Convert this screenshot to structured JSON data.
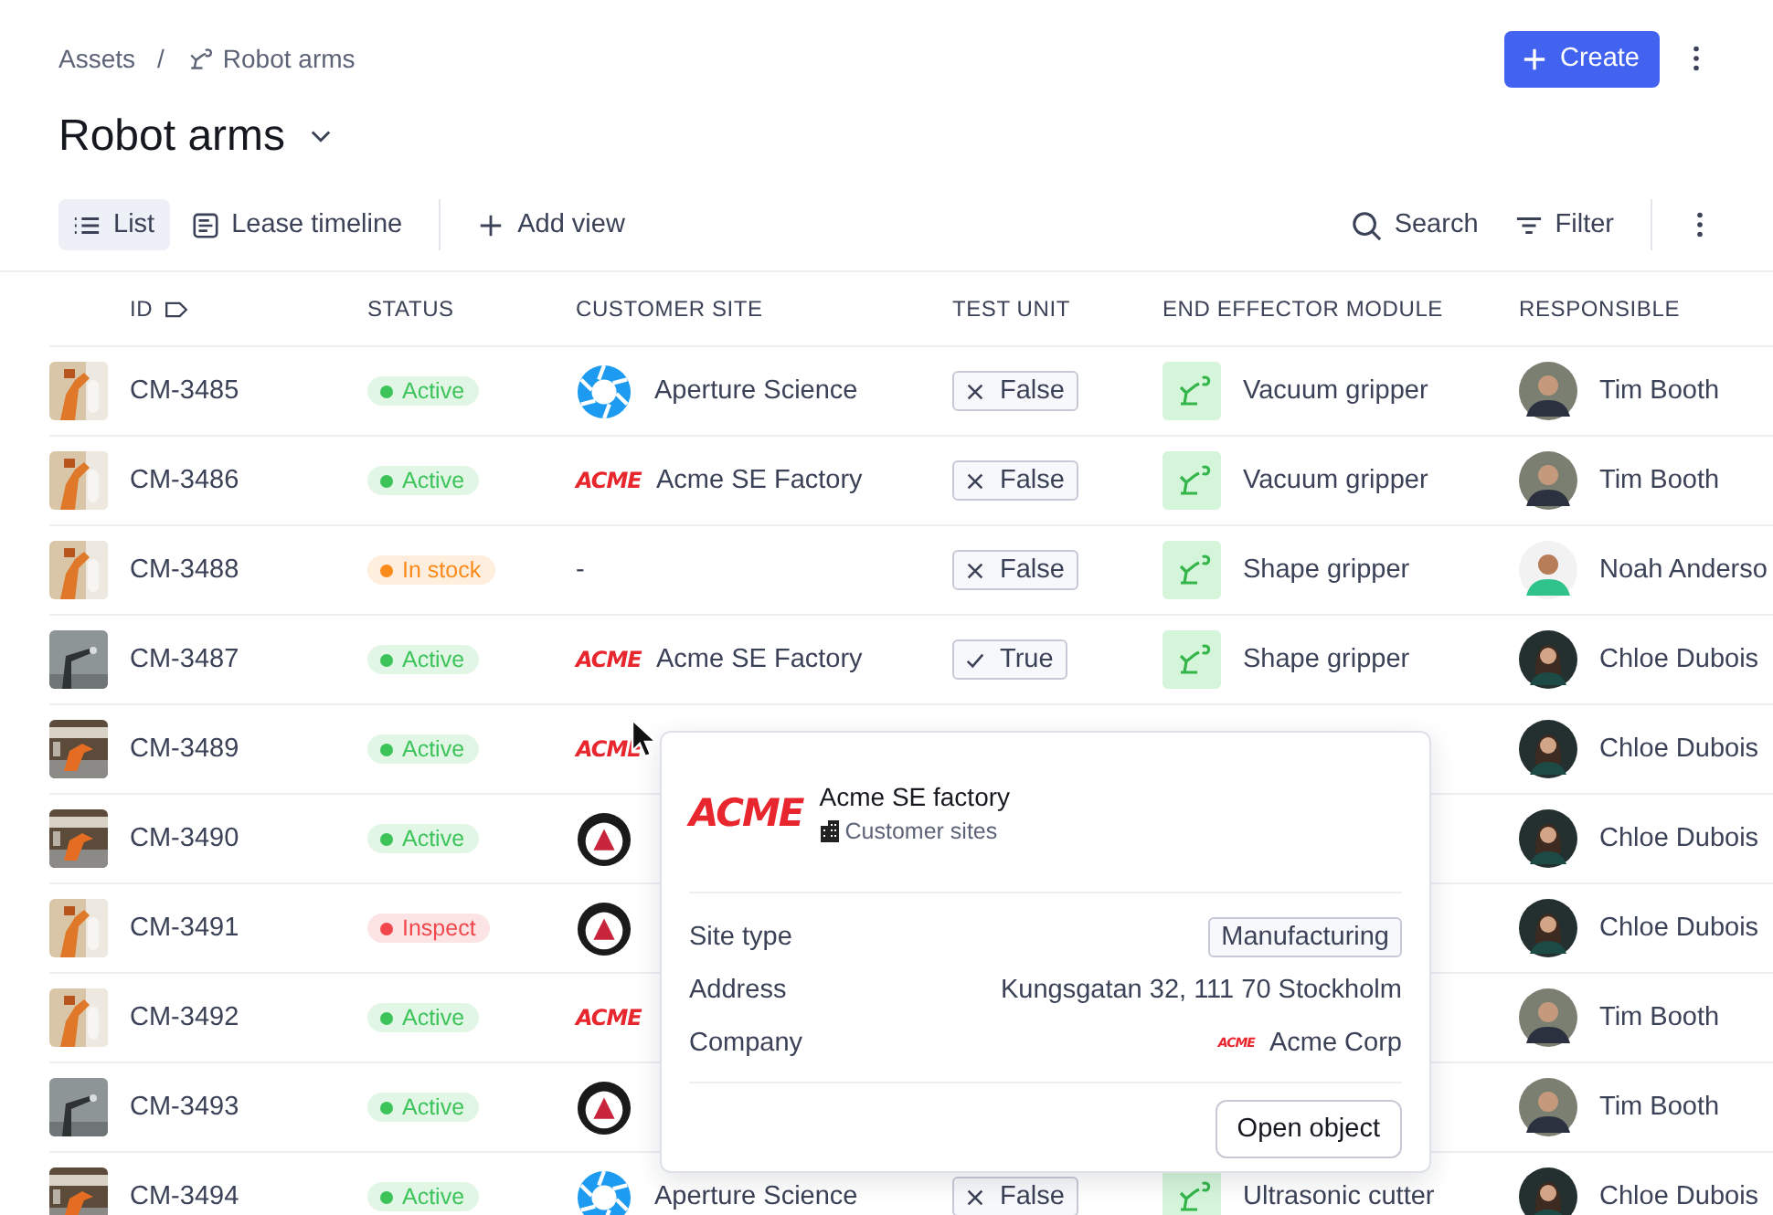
{
  "breadcrumb": [
    {
      "label": "Assets"
    },
    {
      "label": "Robot arms"
    }
  ],
  "breadcrumb_separator": "/",
  "create_button": "Create",
  "title": "Robot arms",
  "views": [
    {
      "label": "List",
      "selected": true
    },
    {
      "label": "Lease timeline",
      "selected": false
    }
  ],
  "add_view": "Add view",
  "search": "Search",
  "filter": "Filter",
  "columns": [
    "ID",
    "STATUS",
    "CUSTOMER SITE",
    "TEST UNIT",
    "END EFFECTOR MODULE",
    "RESPONSIBLE"
  ],
  "rows": [
    {
      "id": "CM-3485",
      "status": {
        "label": "Active",
        "color": "#3cc35a"
      },
      "site": {
        "kind": "aperture",
        "name": "Aperture Science"
      },
      "test_unit": {
        "label": "False",
        "checked": false
      },
      "module": "Vacuum gripper",
      "responsible": "Tim Booth"
    },
    {
      "id": "CM-3486",
      "status": {
        "label": "Active",
        "color": "#3cc35a"
      },
      "site": {
        "kind": "acme",
        "logo_text": "ACME",
        "name": "Acme SE Factory"
      },
      "test_unit": {
        "label": "False",
        "checked": false
      },
      "module": "Vacuum gripper",
      "responsible": "Tim Booth"
    },
    {
      "id": "CM-3488",
      "status": {
        "label": "In stock",
        "color": "#fb8a1c"
      },
      "site": {
        "kind": "none",
        "name": "-"
      },
      "test_unit": {
        "label": "False",
        "checked": false
      },
      "module": "Shape gripper",
      "responsible": "Noah Anderso"
    },
    {
      "id": "CM-3487",
      "status": {
        "label": "Active",
        "color": "#3cc35a"
      },
      "site": {
        "kind": "acme",
        "logo_text": "ACME",
        "name": "Acme SE Factory"
      },
      "test_unit": {
        "label": "True",
        "checked": true
      },
      "module": "Shape gripper",
      "responsible": "Chloe Dubois"
    },
    {
      "id": "CM-3489",
      "status": {
        "label": "Active",
        "color": "#3cc35a"
      },
      "site": {
        "kind": "acme",
        "logo_text": "ACME"
      },
      "responsible": "Chloe Dubois"
    },
    {
      "id": "CM-3490",
      "status": {
        "label": "Active",
        "color": "#3cc35a"
      },
      "site": {
        "kind": "triangle"
      },
      "responsible": "Chloe Dubois"
    },
    {
      "id": "CM-3491",
      "status": {
        "label": "Inspect",
        "color": "#f0474d"
      },
      "site": {
        "kind": "triangle"
      },
      "responsible": "Chloe Dubois"
    },
    {
      "id": "CM-3492",
      "status": {
        "label": "Active",
        "color": "#3cc35a"
      },
      "site": {
        "kind": "acme",
        "logo_text": "ACME"
      },
      "responsible": "Tim Booth"
    },
    {
      "id": "CM-3493",
      "status": {
        "label": "Active",
        "color": "#3cc35a"
      },
      "site": {
        "kind": "triangle"
      },
      "responsible": "Tim Booth"
    },
    {
      "id": "CM-3494",
      "status": {
        "label": "Active",
        "color": "#3cc35a"
      },
      "site": {
        "kind": "aperture",
        "name": "Aperture Science"
      },
      "test_unit": {
        "label": "False",
        "checked": false
      },
      "module": "Ultrasonic cutter",
      "responsible": "Chloe Dubois"
    }
  ],
  "popup": {
    "logo_text": "ACME",
    "title": "Acme SE factory",
    "subtitle": "Customer sites",
    "fields": [
      {
        "label": "Site type",
        "kind": "tag",
        "value": "Manufacturing"
      },
      {
        "label": "Address",
        "kind": "text",
        "value": "Kungsgatan 32, 111 70 Stockholm"
      },
      {
        "label": "Company",
        "kind": "company",
        "logo_text": "ACME",
        "value": "Acme Corp"
      }
    ],
    "button": "Open object"
  }
}
